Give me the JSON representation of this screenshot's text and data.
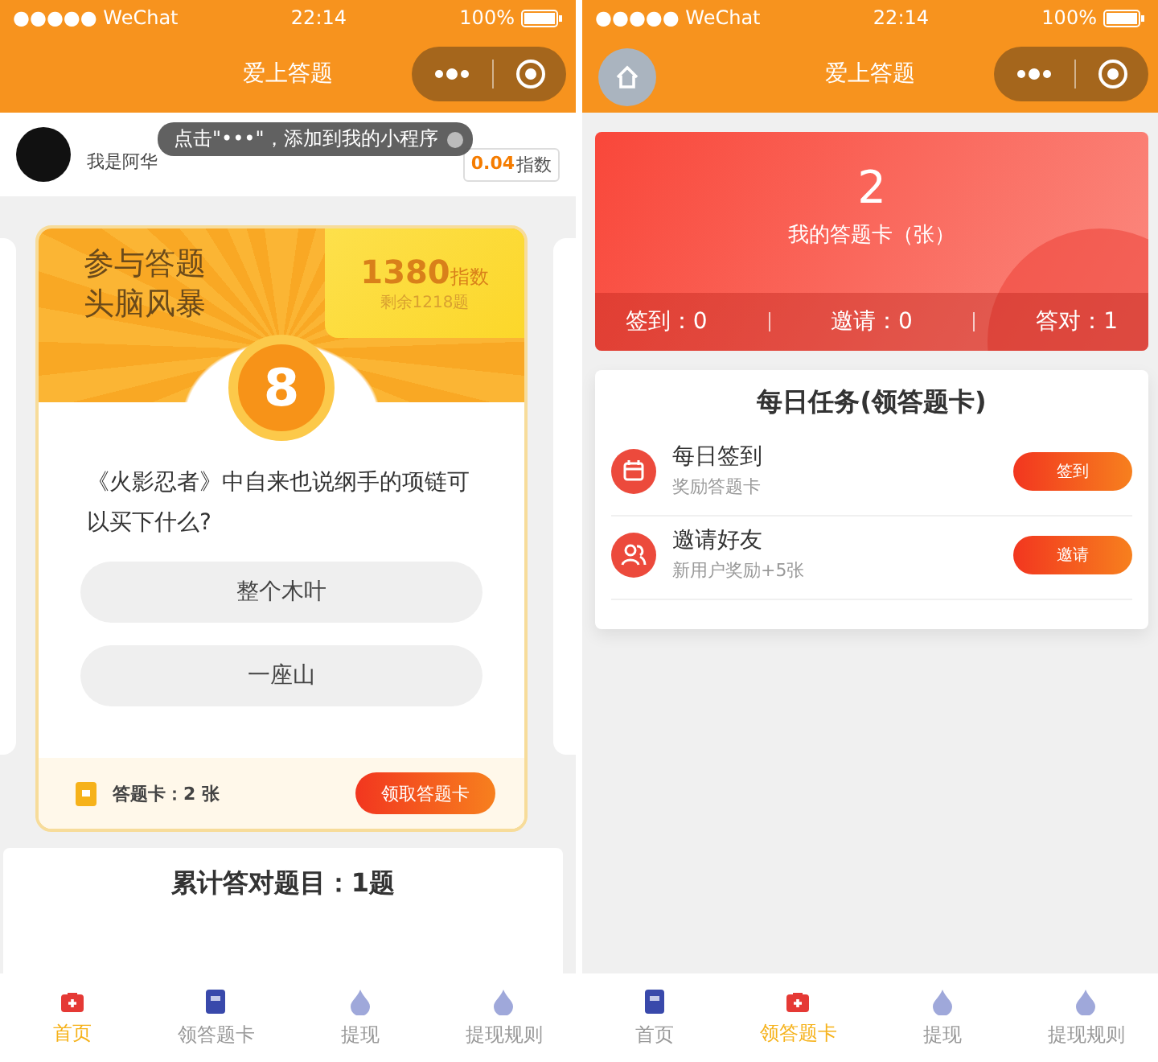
{
  "screens": [
    {
      "status_bar": {
        "carrier": "●●●●● WeChat",
        "time": "22:14",
        "battery": "100%"
      },
      "nav_bar": {
        "title": "爱上答题",
        "home_button": false
      },
      "tooltip": "点击\"•••\"，添加到我的小程序",
      "user": {
        "name": "我是阿华",
        "score": "0.04",
        "score_unit": "指数"
      },
      "quiz_card": {
        "title_lines": [
          "参与答题",
          "头脑风暴"
        ],
        "index": "1380",
        "index_unit": "指数",
        "remaining": "剩余1218题",
        "number": "8",
        "question": "《火影忍者》中自来也说纲手的项链可以买下什么?",
        "options": [
          "整个木叶",
          "一座山"
        ],
        "cards_label": "答题卡：2 张",
        "claim_button": "领取答题卡"
      },
      "total": "累计答对题目：1题",
      "tab_bar": [
        {
          "label": "首页",
          "kind": "kit",
          "selected": true
        },
        {
          "label": "领答题卡",
          "kind": "card",
          "selected": false
        },
        {
          "label": "提现",
          "kind": "drop",
          "selected": false
        },
        {
          "label": "提现规则",
          "kind": "drop",
          "selected": false
        }
      ]
    },
    {
      "status_bar": {
        "carrier": "●●●●● WeChat",
        "time": "22:14",
        "battery": "100%"
      },
      "nav_bar": {
        "title": "爱上答题",
        "home_button": true
      },
      "card_summary": {
        "count": "2",
        "label": "我的答题卡（张）",
        "stats": [
          "签到：0",
          "邀请：0",
          "答对：1"
        ]
      },
      "tasks": {
        "title": "每日任务(领答题卡)",
        "items": [
          {
            "kind": "calendar",
            "title": "每日签到",
            "subtitle": "奖励答题卡",
            "button": "签到"
          },
          {
            "kind": "people",
            "title": "邀请好友",
            "subtitle": "新用户奖励+5张",
            "button": "邀请"
          }
        ]
      },
      "tab_bar": [
        {
          "label": "首页",
          "kind": "card",
          "selected": false
        },
        {
          "label": "领答题卡",
          "kind": "kit",
          "selected": true
        },
        {
          "label": "提现",
          "kind": "drop",
          "selected": false
        },
        {
          "label": "提现规则",
          "kind": "drop",
          "selected": false
        }
      ]
    }
  ]
}
